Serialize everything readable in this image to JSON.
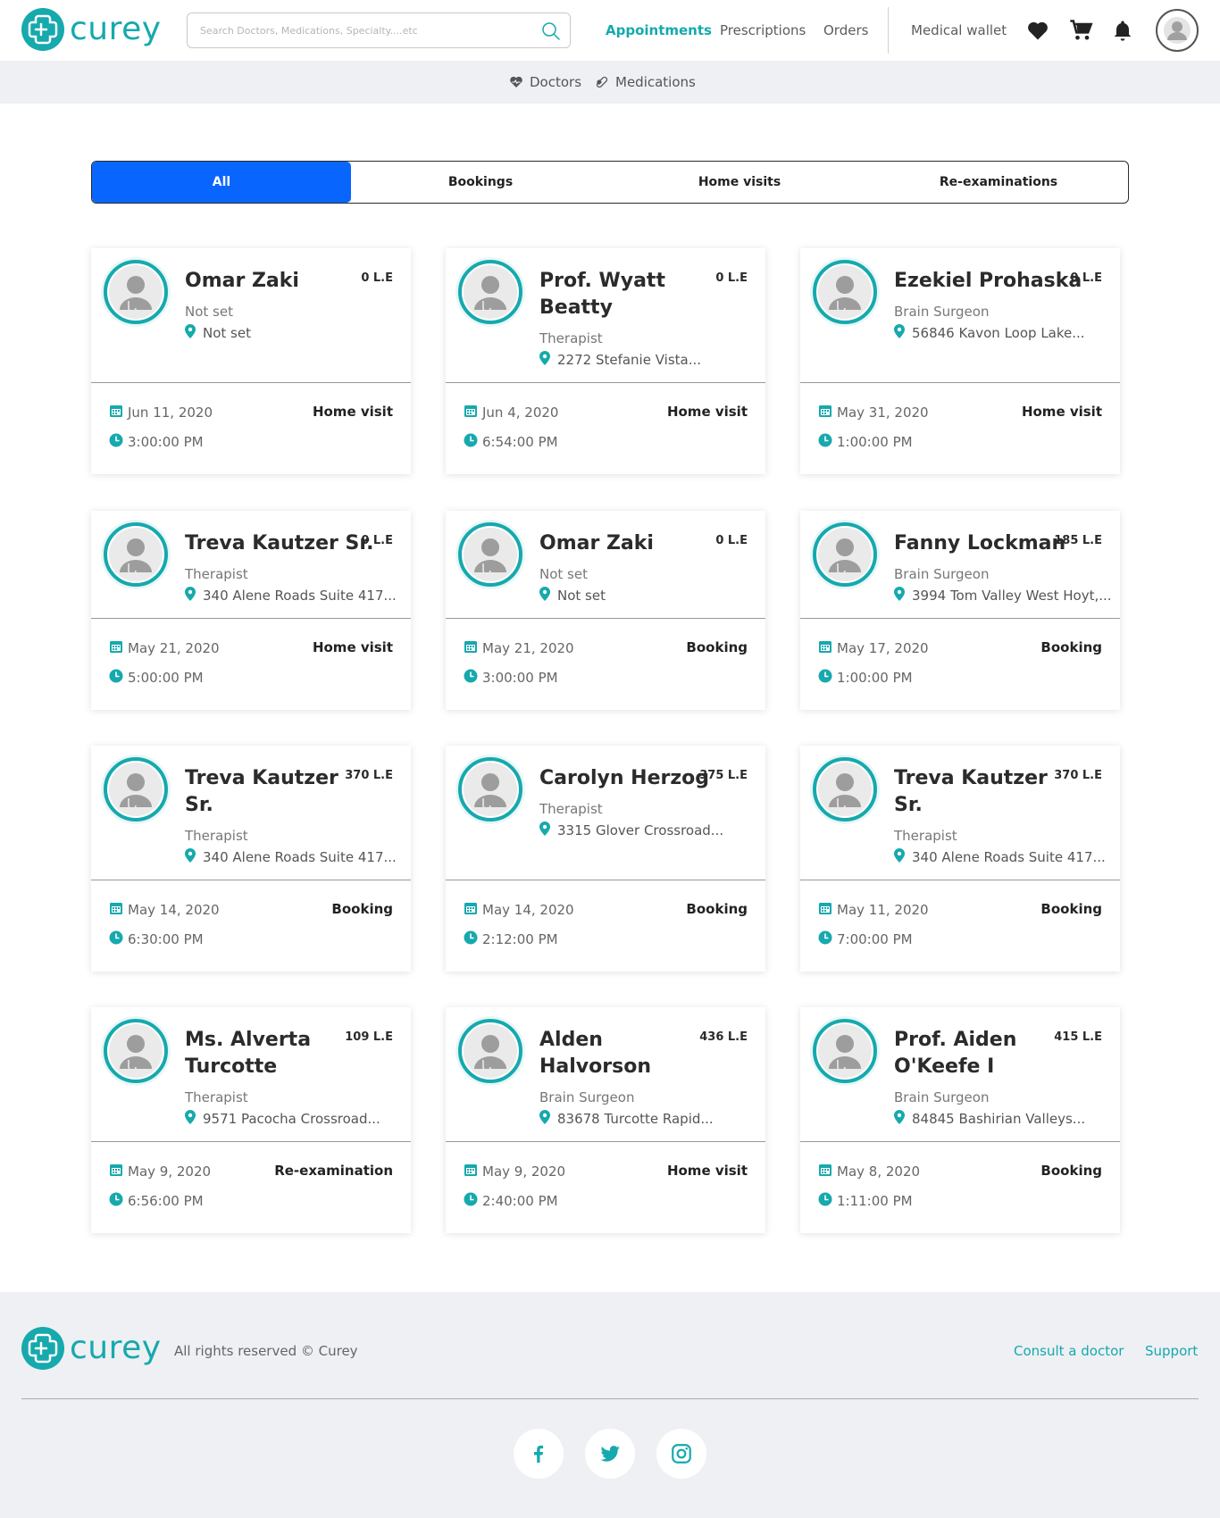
{
  "header": {
    "logo_text": "curey",
    "search_placeholder": "Search Doctors, Medications, Specialty....etc",
    "nav": [
      "Appointments",
      "Prescriptions",
      "Orders"
    ],
    "medical_wallet": "Medical wallet"
  },
  "subnav": {
    "doctors": "Doctors",
    "medications": "Medications"
  },
  "tabs": [
    "All",
    "Bookings",
    "Home visits",
    "Re-examinations"
  ],
  "cards": [
    {
      "name_lines": [
        "Omar Zaki",
        ""
      ],
      "price": "0 L.E",
      "specialty": "Not set",
      "address": "Not set",
      "date": "Jun 11, 2020",
      "time": "3:00:00 PM",
      "type": "Home visit"
    },
    {
      "name_lines": [
        "Prof. Wyatt",
        "Beatty"
      ],
      "price": "0 L.E",
      "specialty": "Therapist",
      "address": "2272 Stefanie Vista...",
      "date": "Jun 4, 2020",
      "time": "6:54:00 PM",
      "type": "Home visit"
    },
    {
      "name_lines": [
        "Ezekiel Prohaska",
        ""
      ],
      "price": "0 L.E",
      "specialty": "Brain Surgeon",
      "address": "56846 Kavon Loop Lake...",
      "date": "May 31, 2020",
      "time": "1:00:00 PM",
      "type": "Home visit"
    },
    {
      "name_lines": [
        "Treva Kautzer Sr.",
        ""
      ],
      "price": "0 L.E",
      "specialty": "Therapist",
      "address": "340 Alene Roads Suite 417...",
      "date": "May 21, 2020",
      "time": "5:00:00 PM",
      "type": "Home visit"
    },
    {
      "name_lines": [
        "Omar Zaki",
        ""
      ],
      "price": "0 L.E",
      "specialty": "Not set",
      "address": "Not set",
      "date": "May 21, 2020",
      "time": "3:00:00 PM",
      "type": "Booking"
    },
    {
      "name_lines": [
        "Fanny Lockman",
        ""
      ],
      "price": "185 L.E",
      "specialty": "Brain Surgeon",
      "address": "3994 Tom Valley West Hoyt,...",
      "date": "May 17, 2020",
      "time": "1:00:00 PM",
      "type": "Booking"
    },
    {
      "name_lines": [
        "Treva Kautzer",
        "Sr."
      ],
      "price": "370 L.E",
      "specialty": "Therapist",
      "address": "340 Alene Roads Suite 417...",
      "date": "May 14, 2020",
      "time": "6:30:00 PM",
      "type": "Booking"
    },
    {
      "name_lines": [
        "Carolyn Herzog",
        ""
      ],
      "price": "375 L.E",
      "specialty": "Therapist",
      "address": "3315 Glover Crossroad...",
      "date": "May 14, 2020",
      "time": "2:12:00 PM",
      "type": "Booking"
    },
    {
      "name_lines": [
        "Treva Kautzer",
        "Sr."
      ],
      "price": "370 L.E",
      "specialty": "Therapist",
      "address": "340 Alene Roads Suite 417...",
      "date": "May 11, 2020",
      "time": "7:00:00 PM",
      "type": "Booking"
    },
    {
      "name_lines": [
        "Ms. Alverta",
        "Turcotte"
      ],
      "price": "109 L.E",
      "specialty": "Therapist",
      "address": "9571 Pacocha Crossroad...",
      "date": "May 9, 2020",
      "time": "6:56:00 PM",
      "type": "Re-examination"
    },
    {
      "name_lines": [
        "Alden",
        "Halvorson"
      ],
      "price": "436 L.E",
      "specialty": "Brain Surgeon",
      "address": "83678 Turcotte Rapid...",
      "date": "May 9, 2020",
      "time": "2:40:00 PM",
      "type": "Home visit"
    },
    {
      "name_lines": [
        "Prof. Aiden",
        "O'Keefe I"
      ],
      "price": "415 L.E",
      "specialty": "Brain Surgeon",
      "address": "84845 Bashirian Valleys...",
      "date": "May 8, 2020",
      "time": "1:11:00 PM",
      "type": "Booking"
    }
  ],
  "footer": {
    "logo_text": "curey",
    "rights": "All rights reserved © Curey",
    "links": [
      "Consult a doctor",
      "Support"
    ]
  },
  "colors": {
    "brand": "#16a9ad",
    "active_tab": "#0866ff",
    "subnav_bg": "#eef0f4"
  }
}
